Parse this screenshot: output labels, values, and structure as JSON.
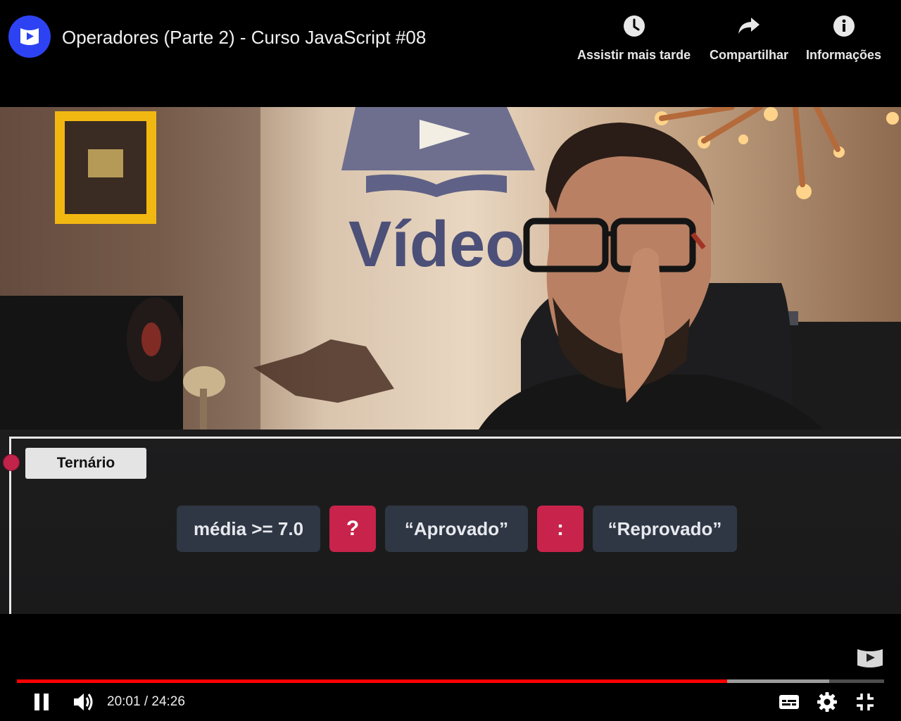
{
  "header": {
    "title": "Operadores (Parte 2) - Curso JavaScript #08",
    "actions": [
      {
        "label": "Assistir mais tarde",
        "icon": "clock-icon"
      },
      {
        "label": "Compartilhar",
        "icon": "share-arrow-icon"
      },
      {
        "label": "Informações",
        "icon": "info-icon"
      }
    ]
  },
  "video": {
    "scene_sign": "Vídeo",
    "overlay": {
      "tag": "Ternário",
      "tokens": [
        {
          "text": "média >= 7.0",
          "style": "grey"
        },
        {
          "text": "?",
          "style": "red"
        },
        {
          "text": "“Aprovado”",
          "style": "grey"
        },
        {
          "text": ":",
          "style": "red"
        },
        {
          "text": "“Reprovado”",
          "style": "grey"
        }
      ]
    }
  },
  "player": {
    "current_time": "20:01",
    "duration": "24:26",
    "time_text": "20:01 / 24:26",
    "played_fraction": 0.819,
    "buffered_fraction": 0.937,
    "colors": {
      "progress": "#ff0000",
      "accent": "#2d43f3",
      "overlay_red": "#c8234a",
      "token_grey": "#2f3744"
    }
  }
}
